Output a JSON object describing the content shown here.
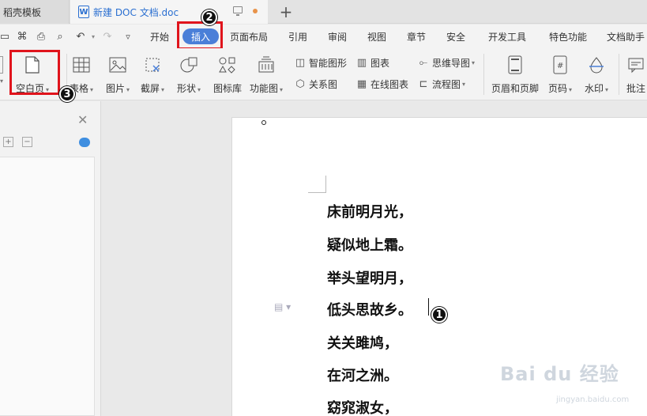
{
  "titlebar": {
    "template_tab": "稻壳模板",
    "doc_tab": "新建 DOC 文档.doc",
    "new_tab": "+"
  },
  "menubar": {
    "items": [
      "开始",
      "插入",
      "页面布局",
      "引用",
      "审阅",
      "视图",
      "章节",
      "安全",
      "开发工具",
      "特色功能",
      "文档助手"
    ],
    "active": "插入"
  },
  "ribbon": {
    "blank_page": "空白页",
    "table": "表格",
    "picture": "图片",
    "screenshot": "截屏",
    "shape": "形状",
    "icon_lib": "图标库",
    "func_chart": "功能图",
    "smart_shape": "智能图形",
    "chart": "图表",
    "mind_map": "思维导图",
    "relation_map": "关系图",
    "online_chart": "在线图表",
    "flowchart": "流程图",
    "header_footer": "页眉和页脚",
    "page_number": "页码",
    "watermark": "水印",
    "comment": "批注"
  },
  "badges": {
    "one": "1",
    "two": "2",
    "three": "3"
  },
  "document": {
    "lines": [
      "床前明月光，",
      "疑似地上霜。",
      "举头望明月，",
      "低头思故乡。",
      "关关雎鸠，",
      "在河之洲。",
      "窈窕淑女，"
    ]
  },
  "watermark": {
    "main": "Bai du 经验",
    "sub": "jingyan.baidu.com"
  },
  "colors": {
    "accent": "#4a7fd8",
    "highlight_red": "#e0141c"
  }
}
